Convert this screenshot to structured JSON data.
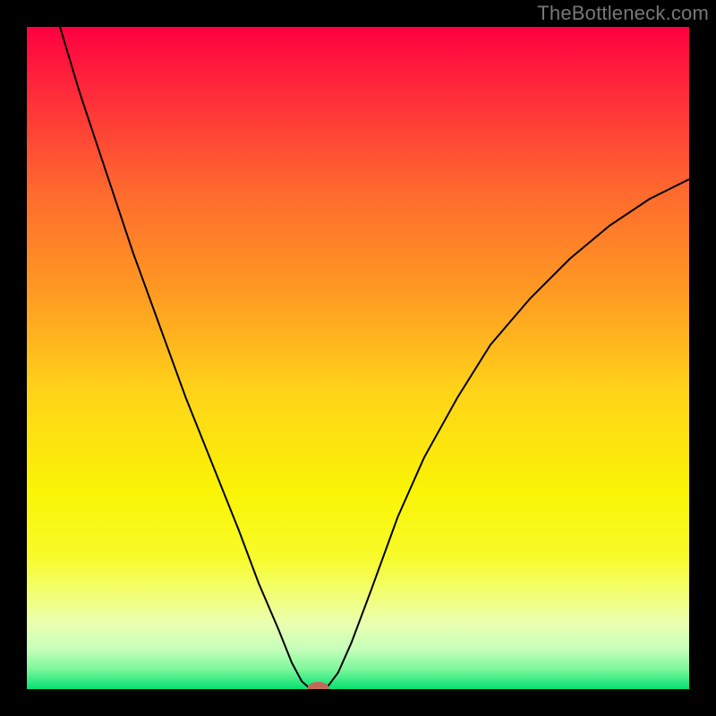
{
  "watermark": "TheBottleneck.com",
  "chart_data": {
    "type": "line",
    "title": "",
    "xlabel": "",
    "ylabel": "",
    "xlim": [
      0,
      100
    ],
    "ylim": [
      0,
      100
    ],
    "background_gradient": {
      "stops": [
        {
          "offset": 0.0,
          "color": "#ff0040"
        },
        {
          "offset": 0.1,
          "color": "#ff2b3a"
        },
        {
          "offset": 0.25,
          "color": "#ff6a2e"
        },
        {
          "offset": 0.4,
          "color": "#ff9a22"
        },
        {
          "offset": 0.55,
          "color": "#ffd319"
        },
        {
          "offset": 0.7,
          "color": "#faf405"
        },
        {
          "offset": 0.8,
          "color": "#f7fb29"
        },
        {
          "offset": 0.86,
          "color": "#f2ff7a"
        },
        {
          "offset": 0.9,
          "color": "#eaffb0"
        },
        {
          "offset": 0.94,
          "color": "#c6ffba"
        },
        {
          "offset": 0.97,
          "color": "#7cf79a"
        },
        {
          "offset": 1.0,
          "color": "#05e072"
        }
      ]
    },
    "series": [
      {
        "name": "bottleneck-curve",
        "color": "#000000",
        "points": [
          {
            "x": 5.0,
            "y": 100.0
          },
          {
            "x": 8.0,
            "y": 90.0
          },
          {
            "x": 12.0,
            "y": 78.0
          },
          {
            "x": 16.0,
            "y": 66.0
          },
          {
            "x": 20.0,
            "y": 55.0
          },
          {
            "x": 24.0,
            "y": 44.0
          },
          {
            "x": 28.0,
            "y": 34.0
          },
          {
            "x": 32.0,
            "y": 24.0
          },
          {
            "x": 35.0,
            "y": 16.0
          },
          {
            "x": 38.0,
            "y": 9.0
          },
          {
            "x": 40.0,
            "y": 4.0
          },
          {
            "x": 41.5,
            "y": 1.2
          },
          {
            "x": 42.5,
            "y": 0.3
          },
          {
            "x": 43.5,
            "y": 0.0
          },
          {
            "x": 44.5,
            "y": 0.0
          },
          {
            "x": 45.5,
            "y": 0.5
          },
          {
            "x": 47.0,
            "y": 2.5
          },
          {
            "x": 49.0,
            "y": 7.0
          },
          {
            "x": 52.0,
            "y": 15.0
          },
          {
            "x": 56.0,
            "y": 26.0
          },
          {
            "x": 60.0,
            "y": 35.0
          },
          {
            "x": 65.0,
            "y": 44.0
          },
          {
            "x": 70.0,
            "y": 52.0
          },
          {
            "x": 76.0,
            "y": 59.0
          },
          {
            "x": 82.0,
            "y": 65.0
          },
          {
            "x": 88.0,
            "y": 70.0
          },
          {
            "x": 94.0,
            "y": 74.0
          },
          {
            "x": 100.0,
            "y": 77.0
          }
        ]
      }
    ],
    "marker": {
      "name": "optimal-point",
      "x": 44.0,
      "y": 0.0,
      "color": "#c26a5a",
      "rx": 1.6,
      "ry": 0.9
    }
  }
}
